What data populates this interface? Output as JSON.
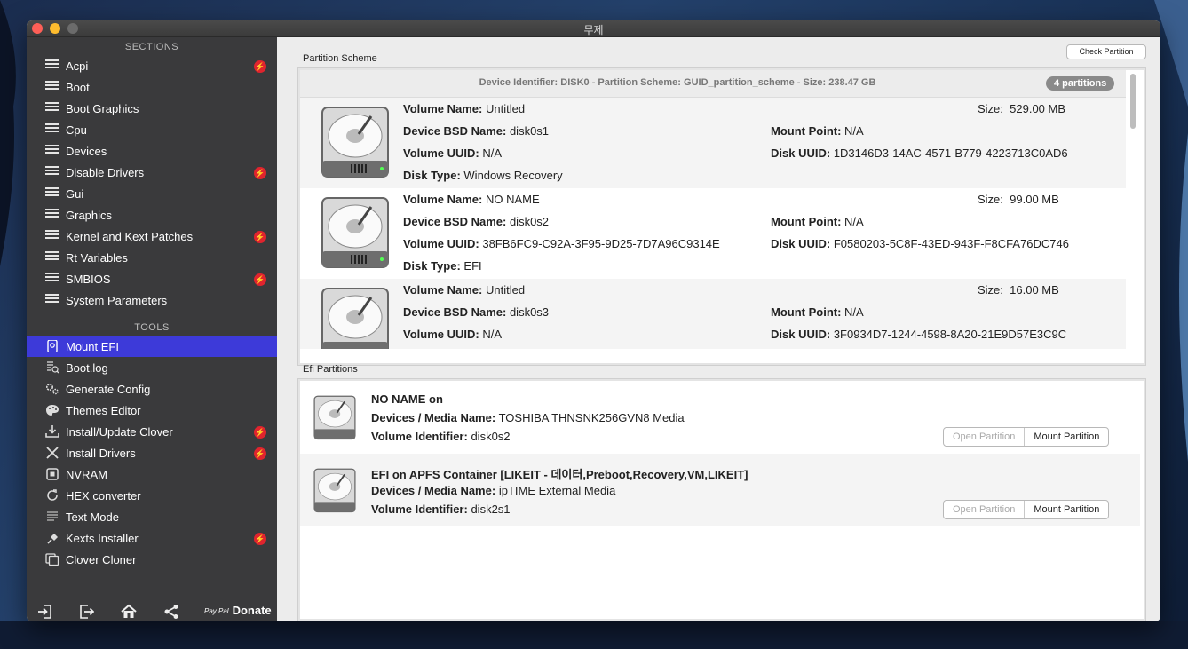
{
  "window": {
    "title": "무제"
  },
  "sidebar": {
    "sections_header": "SECTIONS",
    "tools_header": "TOOLS",
    "sections": [
      {
        "label": "Acpi",
        "badge": true
      },
      {
        "label": "Boot",
        "badge": false
      },
      {
        "label": "Boot Graphics",
        "badge": false
      },
      {
        "label": "Cpu",
        "badge": false
      },
      {
        "label": "Devices",
        "badge": false
      },
      {
        "label": "Disable Drivers",
        "badge": true
      },
      {
        "label": "Gui",
        "badge": false
      },
      {
        "label": "Graphics",
        "badge": false
      },
      {
        "label": "Kernel and Kext Patches",
        "badge": true
      },
      {
        "label": "Rt Variables",
        "badge": false
      },
      {
        "label": "SMBIOS",
        "badge": true
      },
      {
        "label": "System Parameters",
        "badge": false
      }
    ],
    "tools": [
      {
        "label": "Mount EFI",
        "icon": "disk-icon",
        "active": true,
        "badge": false
      },
      {
        "label": "Boot.log",
        "icon": "log-icon",
        "badge": false
      },
      {
        "label": "Generate Config",
        "icon": "gears-icon",
        "badge": false
      },
      {
        "label": "Themes Editor",
        "icon": "palette-icon",
        "badge": false
      },
      {
        "label": "Install/Update Clover",
        "icon": "download-icon",
        "badge": true
      },
      {
        "label": "Install Drivers",
        "icon": "tools-icon",
        "badge": true
      },
      {
        "label": "NVRAM",
        "icon": "chip-icon",
        "badge": false
      },
      {
        "label": "HEX converter",
        "icon": "refresh-icon",
        "badge": false
      },
      {
        "label": "Text Mode",
        "icon": "text-icon",
        "badge": false
      },
      {
        "label": "Kexts Installer",
        "icon": "plug-icon",
        "badge": true
      },
      {
        "label": "Clover Cloner",
        "icon": "copy-icon",
        "badge": false
      }
    ],
    "badge_glyph": "⚡",
    "donate_prefix": "Pay Pal",
    "donate_label": "Donate"
  },
  "main": {
    "check_partition_label": "Check Partition",
    "partition_scheme_label": "Partition Scheme",
    "scheme_summary": "Device Identifier: DISK0 - Partition Scheme: GUID_partition_scheme - Size: 238.47 GB",
    "partition_count": "4 partitions",
    "labels": {
      "volume_name": "Volume Name:",
      "bsd_name": "Device BSD Name:",
      "volume_uuid": "Volume UUID:",
      "disk_type": "Disk Type:",
      "size": "Size:",
      "mount_point": "Mount Point:",
      "disk_uuid": "Disk UUID:",
      "media_name": "Devices / Media Name:",
      "volume_identifier": "Volume Identifier:"
    },
    "partitions": [
      {
        "volume_name": "Untitled",
        "bsd_name": "disk0s1",
        "volume_uuid": "N/A",
        "disk_type": "Windows Recovery",
        "size": "529.00 MB",
        "mount_point": "N/A",
        "disk_uuid": "1D3146D3-14AC-4571-B779-4223713C0AD6"
      },
      {
        "volume_name": "NO NAME",
        "bsd_name": "disk0s2",
        "volume_uuid": "38FB6FC9-C92A-3F95-9D25-7D7A96C9314E",
        "disk_type": "EFI",
        "size": "99.00 MB",
        "mount_point": "N/A",
        "disk_uuid": "F0580203-5C8F-43ED-943F-F8CFA76DC746"
      },
      {
        "volume_name": "Untitled",
        "bsd_name": "disk0s3",
        "volume_uuid": "N/A",
        "disk_type": "",
        "size": "16.00 MB",
        "mount_point": "N/A",
        "disk_uuid": "3F0934D7-1244-4598-8A20-21E9D57E3C9C"
      }
    ],
    "efi_partitions_label": "Efi Partitions",
    "efi_partitions": [
      {
        "title": "NO NAME on",
        "media_name": "TOSHIBA THNSNK256GVN8 Media",
        "volume_identifier": "disk0s2"
      },
      {
        "title": "EFI on APFS Container [LIKEIT - 데이터,Preboot,Recovery,VM,LIKEIT]",
        "media_name": "ipTIME External Media",
        "volume_identifier": "disk2s1"
      }
    ],
    "open_partition_label": "Open Partition",
    "mount_partition_label": "Mount Partition"
  }
}
